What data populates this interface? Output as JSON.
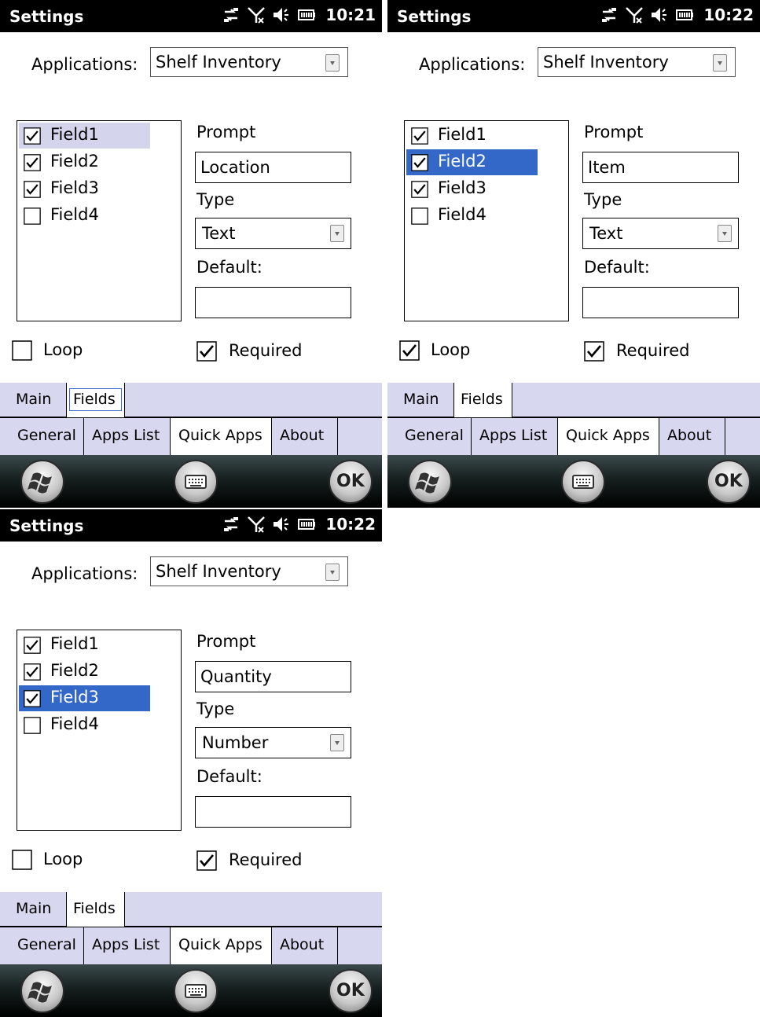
{
  "screens": [
    {
      "statusbar": {
        "title": "Settings",
        "time": "10:21"
      },
      "applications": {
        "label": "Applications:",
        "value": "Shelf Inventory"
      },
      "fields": [
        {
          "label": "Field1",
          "checked": true
        },
        {
          "label": "Field2",
          "checked": true
        },
        {
          "label": "Field3",
          "checked": true
        },
        {
          "label": "Field4",
          "checked": false
        }
      ],
      "selected_field": "Field1",
      "prompt_label": "Prompt",
      "prompt_value": "Location",
      "type_label": "Type",
      "type_value": "Text",
      "default_label": "Default:",
      "default_value": "",
      "loop": {
        "label": "Loop",
        "checked": false
      },
      "required": {
        "label": "Required",
        "checked": true
      },
      "tabs_top": [
        "Main",
        "Fields"
      ],
      "tabs_bottom": [
        "General",
        "Apps List",
        "Quick Apps",
        "About"
      ],
      "ok_label": "OK"
    },
    {
      "statusbar": {
        "title": "Settings",
        "time": "10:22"
      },
      "applications": {
        "label": "Applications:",
        "value": "Shelf Inventory"
      },
      "fields": [
        {
          "label": "Field1",
          "checked": true
        },
        {
          "label": "Field2",
          "checked": true
        },
        {
          "label": "Field3",
          "checked": true
        },
        {
          "label": "Field4",
          "checked": false
        }
      ],
      "selected_field": "Field2",
      "prompt_label": "Prompt",
      "prompt_value": "Item",
      "type_label": "Type",
      "type_value": "Text",
      "default_label": "Default:",
      "default_value": "",
      "loop": {
        "label": "Loop",
        "checked": true
      },
      "required": {
        "label": "Required",
        "checked": true
      },
      "tabs_top": [
        "Main",
        "Fields"
      ],
      "tabs_bottom": [
        "General",
        "Apps List",
        "Quick Apps",
        "About"
      ],
      "ok_label": "OK"
    },
    {
      "statusbar": {
        "title": "Settings",
        "time": "10:22"
      },
      "applications": {
        "label": "Applications:",
        "value": "Shelf Inventory"
      },
      "fields": [
        {
          "label": "Field1",
          "checked": true
        },
        {
          "label": "Field2",
          "checked": true
        },
        {
          "label": "Field3",
          "checked": true
        },
        {
          "label": "Field4",
          "checked": false
        }
      ],
      "selected_field": "Field3",
      "prompt_label": "Prompt",
      "prompt_value": "Quantity",
      "type_label": "Type",
      "type_value": "Number",
      "default_label": "Default:",
      "default_value": "",
      "loop": {
        "label": "Loop",
        "checked": false
      },
      "required": {
        "label": "Required",
        "checked": true
      },
      "tabs_top": [
        "Main",
        "Fields"
      ],
      "tabs_bottom": [
        "General",
        "Apps List",
        "Quick Apps",
        "About"
      ],
      "ok_label": "OK"
    }
  ],
  "colors": {
    "selection_focused": "#3468c8",
    "selection_unfocused": "#d4d4ec",
    "tab_background": "#d7d7ef",
    "statusbar": "#000000"
  },
  "icons": [
    "connection-icon",
    "no-signal-icon",
    "speaker-muted-icon",
    "battery-icon",
    "windows-start-icon",
    "keyboard-icon"
  ]
}
